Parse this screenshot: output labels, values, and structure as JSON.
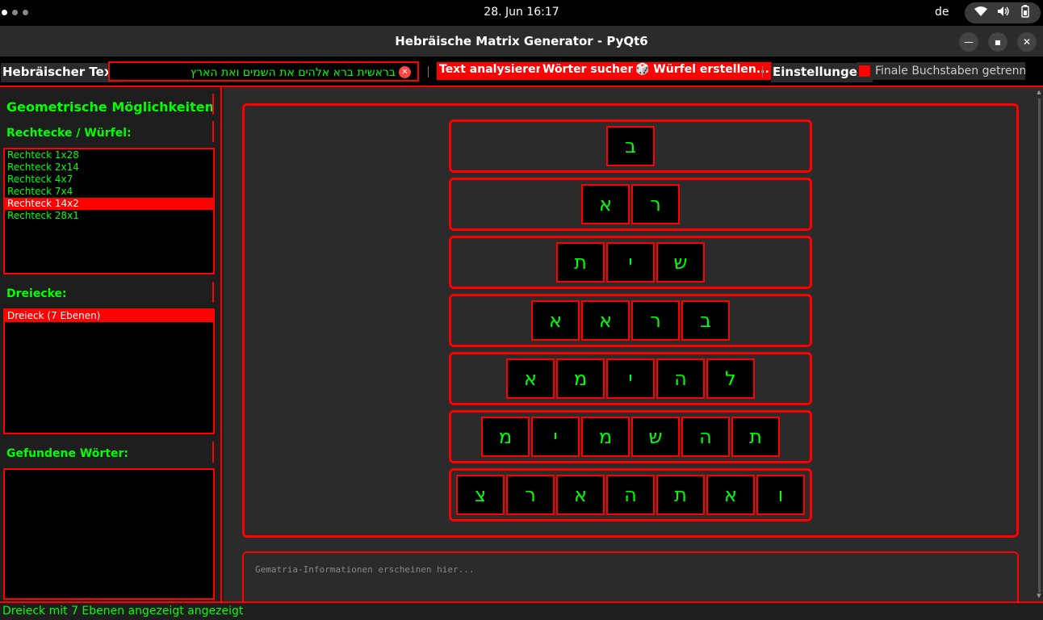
{
  "system_bar": {
    "datetime": "28. Jun  16:17",
    "language": "de"
  },
  "window": {
    "title": "Hebräische Matrix Generator - PyQt6"
  },
  "toolbar": {
    "text_label": "Hebräischer Text:",
    "text_value": "בראשית ברא אלהים את השמים ואת הארץ",
    "analyze_label": "Text analysieren",
    "search_label": "Wörter suchen",
    "cube_label": "🎲 Würfel erstellen...",
    "settings_label": "Einstellungen:",
    "final_letters_label": "Finale Buchstaben getrennt",
    "final_letters_checked": true
  },
  "sidebar": {
    "title": "Geometrische Möglichkeiten",
    "rect_heading": "Rechtecke / Würfel:",
    "rectangles": [
      "Rechteck 1x28",
      "Rechteck 2x14",
      "Rechteck 4x7",
      "Rechteck 7x4",
      "Rechteck 14x2",
      "Rechteck 28x1"
    ],
    "rect_selected_index": 4,
    "tri_heading": "Dreiecke:",
    "triangles": [
      "Dreieck (7 Ebenen)"
    ],
    "tri_selected_index": 0,
    "words_heading": "Gefundene Wörter:"
  },
  "matrix": {
    "rows": [
      [
        "ב"
      ],
      [
        "א",
        "ר"
      ],
      [
        "ת",
        "י",
        "ש"
      ],
      [
        "א",
        "א",
        "ר",
        "ב"
      ],
      [
        "א",
        "מ",
        "י",
        "ה",
        "ל"
      ],
      [
        "מ",
        "י",
        "מ",
        "ש",
        "ה",
        "ת"
      ],
      [
        "צ",
        "ר",
        "א",
        "ה",
        "ת",
        "א",
        "ו"
      ]
    ]
  },
  "info": {
    "placeholder": "Gematria-Informationen erscheinen hier..."
  },
  "status": {
    "message": "Dreieck mit 7 Ebenen angezeigt angezeigt"
  }
}
